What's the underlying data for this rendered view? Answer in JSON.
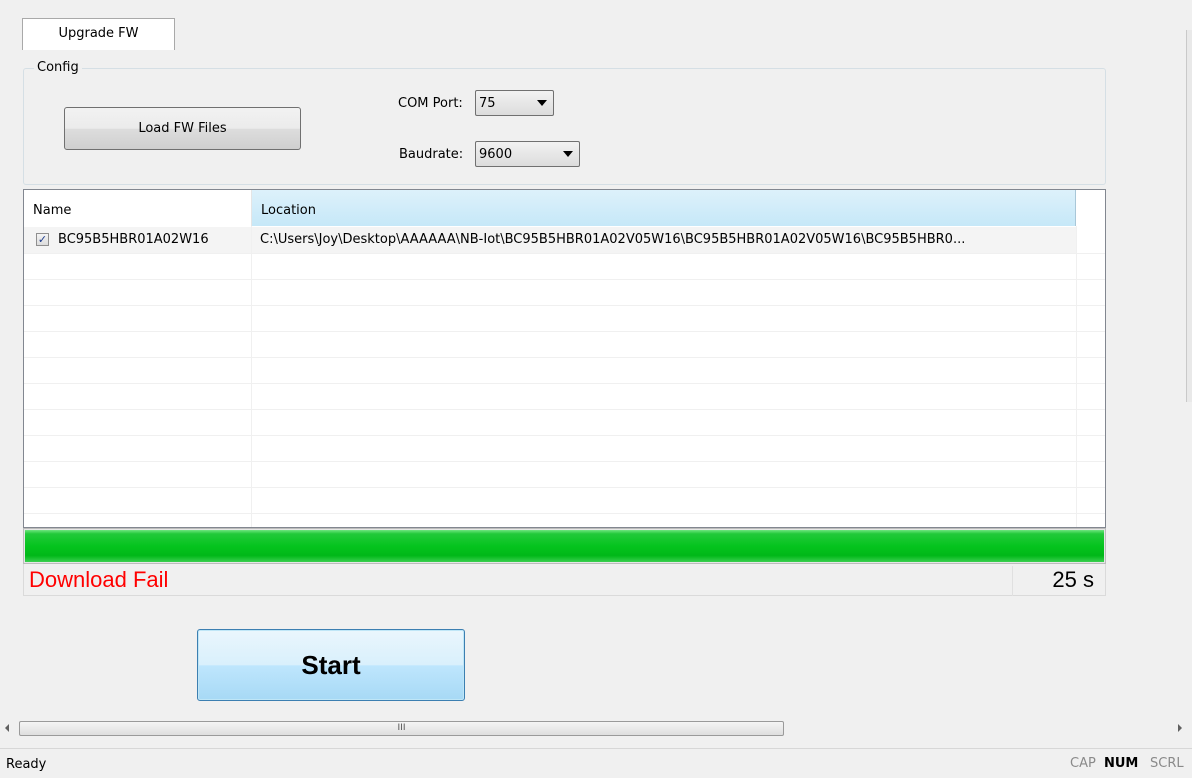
{
  "tab": {
    "label": "Upgrade FW"
  },
  "config": {
    "group_label": "Config",
    "load_button": "Load FW Files",
    "com_port_label": "COM Port:",
    "com_port_value": "75",
    "baudrate_label": "Baudrate:",
    "baudrate_value": "9600"
  },
  "file_list": {
    "columns": [
      "Name",
      "Location"
    ],
    "rows": [
      {
        "checked": true,
        "name": "BC95B5HBR01A02W16",
        "location": "C:\\Users\\Joy\\Desktop\\AAAAAA\\NB-Iot\\BC95B5HBR01A02V05W16\\BC95B5HBR01A02V05W16\\BC95B5HBR0..."
      }
    ]
  },
  "progress": {
    "value": 1.0,
    "color": "#00c41e"
  },
  "result": {
    "text": "Download Fail",
    "color": "#ff0000",
    "elapsed": "25 s"
  },
  "start_button": "Start",
  "scrollbar": {
    "grip": "III"
  },
  "status_bar": {
    "text": "Ready",
    "indicators": {
      "cap": "CAP",
      "num": "NUM",
      "scrl": "SCRL"
    }
  }
}
